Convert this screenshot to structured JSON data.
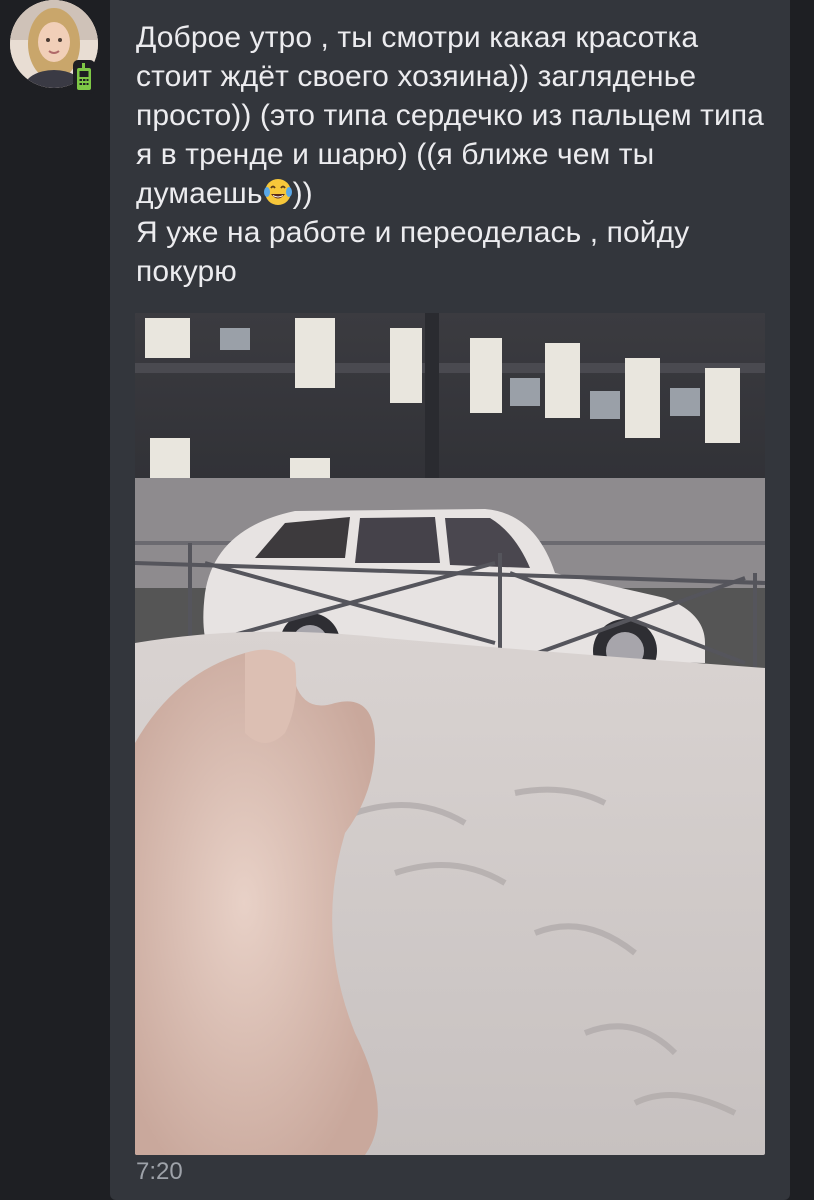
{
  "sender": {
    "avatar_icon": "user-avatar-photo",
    "status_icon": "mobile-online-icon",
    "status_color": "#7ec846"
  },
  "message": {
    "line1": "Доброе утро , ты смотри какая красотка стоит ждёт своего хозяина)) загляденье просто)) (это типа сердечко из пальцем типа я в тренде и шарю) ((я ближе чем ты думаешь",
    "emoji": "😂",
    "line1_end": "))",
    "line2": "Я уже на работе и переоделась , пойду покурю",
    "photo_description_icon": "attached-photo",
    "time": "7:20"
  },
  "colors": {
    "background": "#1e1f23",
    "bubble": "#33363c",
    "text": "#ececef",
    "time": "#9ea2a9"
  }
}
